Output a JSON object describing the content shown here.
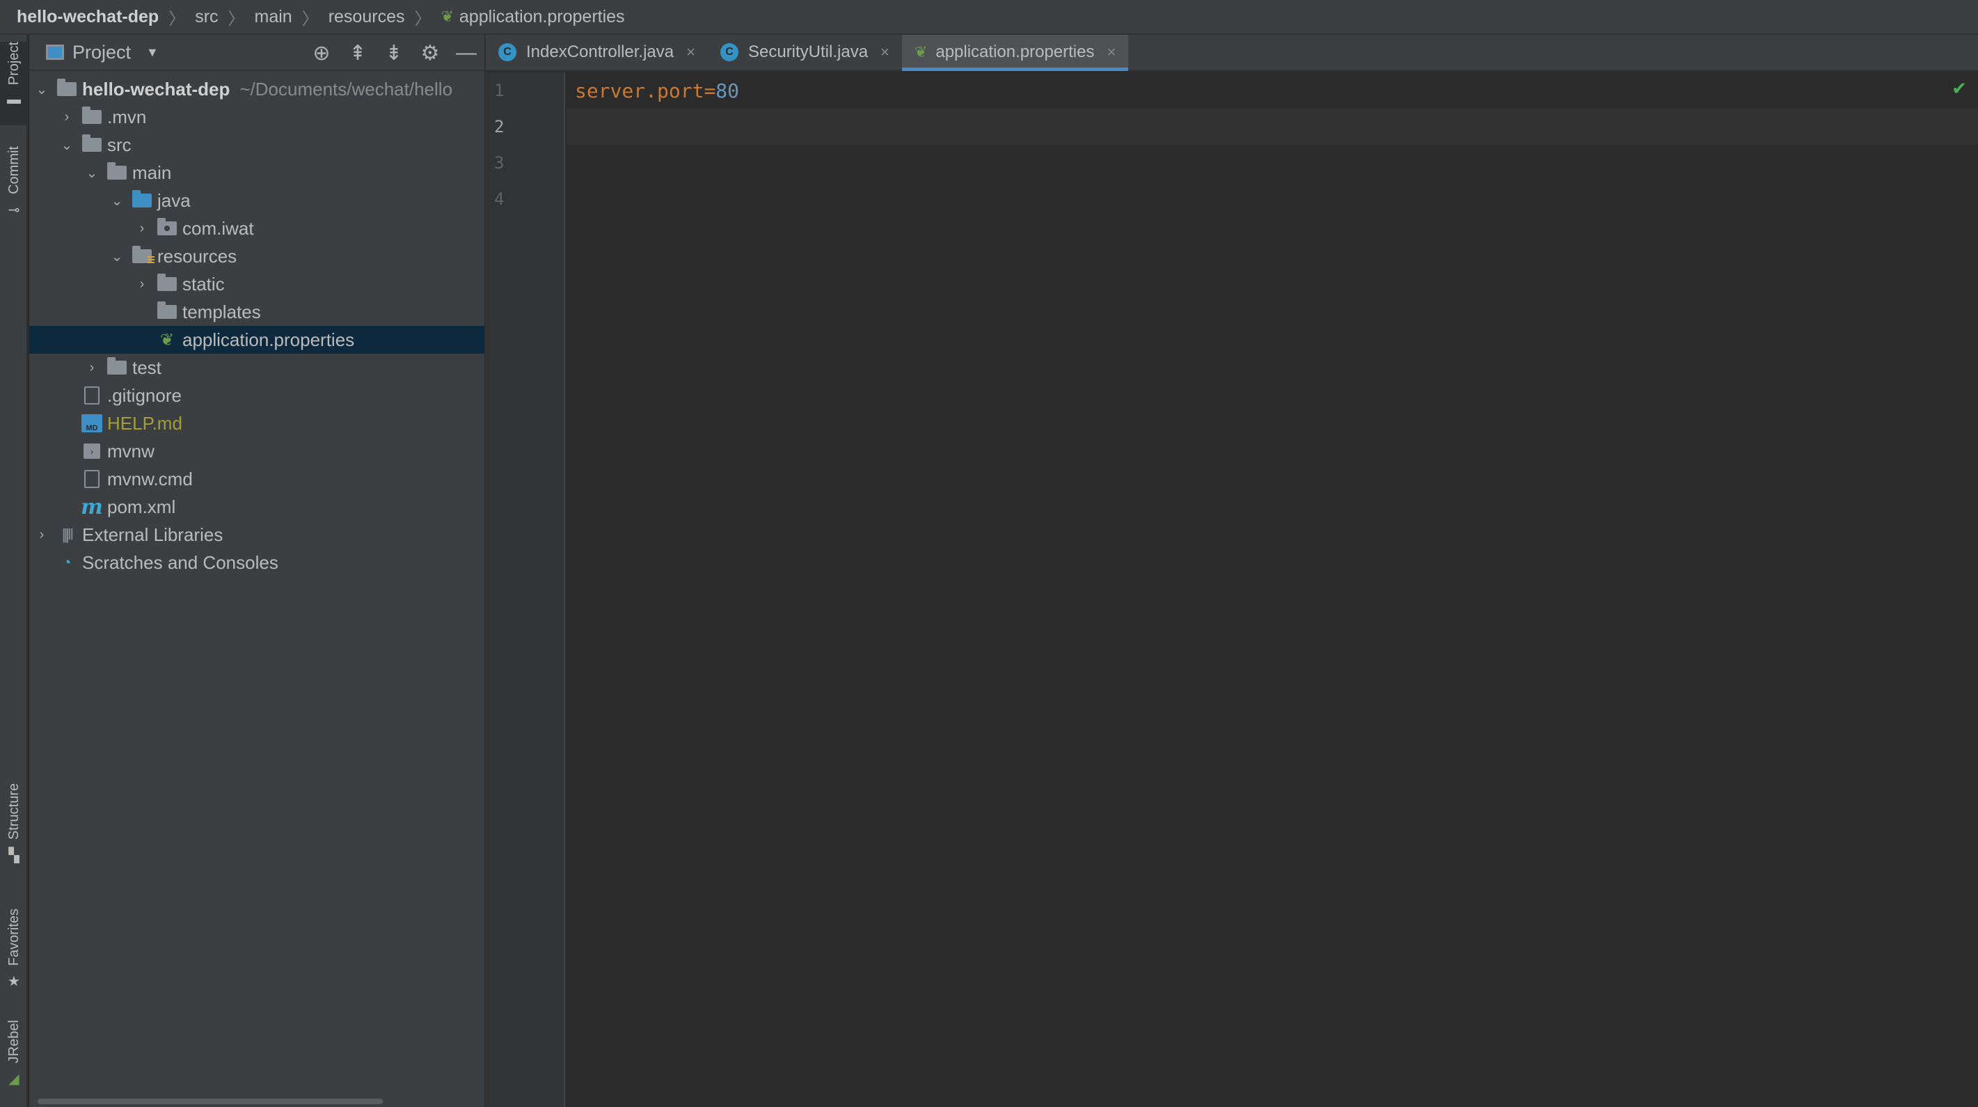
{
  "breadcrumb": {
    "project": "hello-wechat-dep",
    "items": [
      "src",
      "main",
      "resources"
    ],
    "file": "application.properties"
  },
  "left_strip": {
    "project": "Project",
    "commit": "Commit",
    "structure": "Structure",
    "favorites": "Favorites",
    "jrebel": "JRebel"
  },
  "project_panel": {
    "title": "Project",
    "icons": [
      "locate-icon",
      "expand-all-icon",
      "collapse-all-icon",
      "gear-icon",
      "minimize-icon"
    ]
  },
  "tree": {
    "root": {
      "label": "hello-wechat-dep",
      "path": "~/Documents/wechat/hello"
    },
    "mvn": ".mvn",
    "src": "src",
    "main": "main",
    "java": "java",
    "com_iwat": "com.iwat",
    "resources": "resources",
    "static": "static",
    "templates": "templates",
    "app_props": "application.properties",
    "test": "test",
    "gitignore": ".gitignore",
    "help": "HELP.md",
    "mvnw": "mvnw",
    "mvnw_cmd": "mvnw.cmd",
    "pom": "pom.xml",
    "ext_libs": "External Libraries",
    "scratches": "Scratches and Consoles"
  },
  "tabs": [
    {
      "label": "IndexController.java",
      "icon": "C"
    },
    {
      "label": "SecurityUtil.java",
      "icon": "C"
    },
    {
      "label": "application.properties",
      "icon": "spring"
    }
  ],
  "editor": {
    "line_numbers": [
      "1",
      "2",
      "3",
      "4"
    ],
    "line1_key": "server.port",
    "line1_eq": "=",
    "line1_value": "80"
  },
  "colors": {
    "accent": "#4a88c7",
    "keyword": "#cc7832",
    "number": "#6897bb",
    "selection": "#0d293e"
  }
}
